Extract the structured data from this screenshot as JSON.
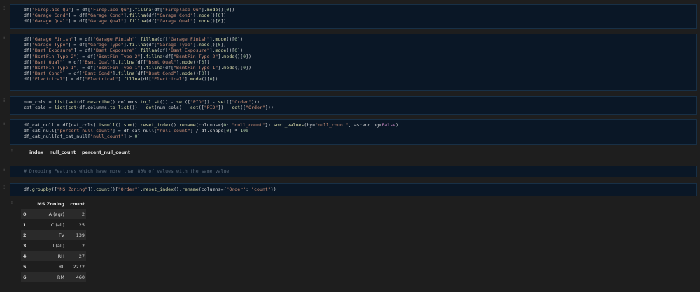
{
  "cells": [
    {
      "id": "cell-fillna-fireplace",
      "lines": [
        "df[\"Fireplace Qu\"] = df[\"Fireplace Qu\"].fillna(df[\"Fireplace Qu\"].mode()[0])",
        "df[\"Garage Cond\"] = df[\"Garage Cond\"].fillna(df[\"Garage Cond\"].mode()[0])",
        "df[\"Garage Qual\"] = df[\"Garage Qual\"].fillna(df[\"Garage Qual\"].mode()[0])"
      ]
    },
    {
      "id": "cell-fillna-garage-bsmt",
      "lines": [
        "df[\"Garage Finish\"] = df[\"Garage Finish\"].fillna(df[\"Garage Finish\"].mode()[0])",
        "df[\"Garage Type\"] = df[\"Garage Type\"].fillna(df[\"Garage Type\"].mode()[0])",
        "df[\"Bsmt Exposure\"] = df[\"Bsmt Exposure\"].fillna(df[\"Bsmt Exposure\"].mode()[0])",
        "df[\"BsmtFin Type 2\"] = df[\"BsmtFin Type 2\"].fillna(df[\"BsmtFin Type 2\"].mode()[0])",
        "df[\"Bsmt Qual\"] = df[\"Bsmt Qual\"].fillna(df[\"Bsmt Qual\"].mode()[0])",
        "df[\"BsmtFin Type 1\"] = df[\"BsmtFin Type 1\"].fillna(df[\"BsmtFin Type 1\"].mode()[0])",
        "df[\"Bsmt Cond\"] = df[\"Bsmt Cond\"].fillna(df[\"Bsmt Cond\"].mode()[0])",
        "df[\"Electrical\"] = df[\"Electrical\"].fillna(df[\"Electrical\"].mode()[0])"
      ]
    },
    {
      "id": "cell-cols",
      "lines": [
        "num_cols = list(set(df.describe().columns.to_list()) - set([\"PID\"]) - set([\"Order\"]))",
        "cat_cols = list(set(df.columns.to_list()) - set(num_cols) - set([\"PID\"]) - set([\"Order\"]))"
      ]
    },
    {
      "id": "cell-null-count",
      "lines": [
        "df_cat_null = df[cat_cols].isnull().sum().reset_index().rename(columns={0: \"null_count\"}).sort_values(by=\"null_count\", ascending=False)",
        "df_cat_null[\"percent_null_count\"] = df_cat_null[\"null_count\"] / df.shape[0] * 100",
        "df_cat_null[df_cat_null[\"null_count\"] > 0]"
      ]
    },
    {
      "id": "cell-comment",
      "lines": [
        "# Dropping Features which have more than 80% of values with the same value"
      ]
    },
    {
      "id": "cell-groupby",
      "lines": [
        "df.groupby([\"MS Zoning\"]).count()[\"Order\"].reset_index().rename(columns={\"Order\": \"count\"})"
      ]
    }
  ],
  "null_output": {
    "headers": [
      "index",
      "null_count",
      "percent_null_count"
    ]
  },
  "zoning_output": {
    "headers": [
      "",
      "MS Zoning",
      "count"
    ],
    "rows": [
      [
        "0",
        "A (agr)",
        "2"
      ],
      [
        "1",
        "C (all)",
        "25"
      ],
      [
        "2",
        "FV",
        "139"
      ],
      [
        "3",
        "I (all)",
        "2"
      ],
      [
        "4",
        "RH",
        "27"
      ],
      [
        "5",
        "RL",
        "2272"
      ],
      [
        "6",
        "RM",
        "460"
      ]
    ]
  },
  "colors": {
    "background": "#1e1e1e",
    "cell_bg": "#0a1726",
    "cell_border": "#183046",
    "string": "#ce9178",
    "number": "#b5cea8",
    "keyword": "#c586c0",
    "comment": "#6a9955"
  }
}
